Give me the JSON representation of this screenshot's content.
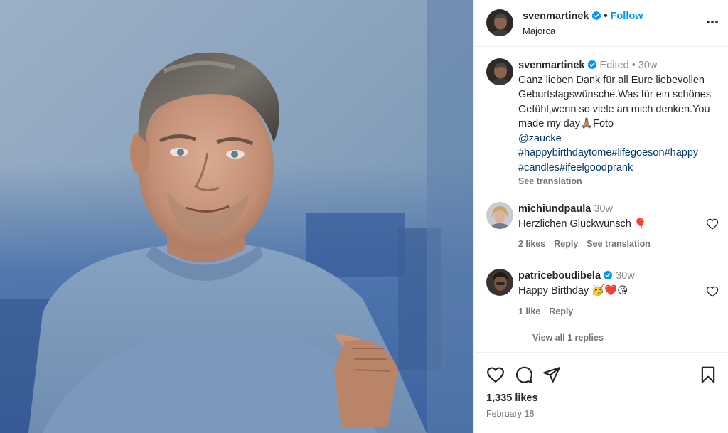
{
  "post": {
    "author": "svenmartinek",
    "follow_label": "Follow",
    "location": "Majorca",
    "caption": {
      "username": "svenmartinek",
      "edited": "Edited",
      "separator": "•",
      "age": "30w",
      "text_part1": "Ganz lieben Dank für all Eure liebevollen Geburtstagswünsche.Was für ein schönes Gefühl,wenn so viele an mich denken.You made my day",
      "emoji": "🙏🏽",
      "text_part2": "Foto",
      "mention": "@zaucke",
      "hashtags_line1": "#happybirthdaytome#lifegoeson#happy",
      "hashtags_line2": "#candles#ifeelgoodprank",
      "see_translation": "See translation"
    },
    "comments": [
      {
        "username": "michiundpaula",
        "age": "30w",
        "text": "Herzlichen Glückwunsch",
        "emoji": "🎈",
        "likes": "2 likes",
        "reply": "Reply",
        "see_translation": "See translation"
      },
      {
        "username": "patriceboudibela",
        "age": "30w",
        "text": "Happy Birthday",
        "emoji": "🥳❤️😘",
        "likes": "1 like",
        "reply": "Reply"
      }
    ],
    "view_replies": "View all 1 replies",
    "likes_count": "1,335 likes",
    "date": "February 18"
  },
  "colors": {
    "accent": "#0095f6",
    "verified": "#0095f6",
    "text": "#262626",
    "muted": "#737373"
  },
  "icons": [
    "verified-icon",
    "more-icon",
    "heart-icon",
    "comment-icon",
    "share-icon",
    "bookmark-icon"
  ]
}
